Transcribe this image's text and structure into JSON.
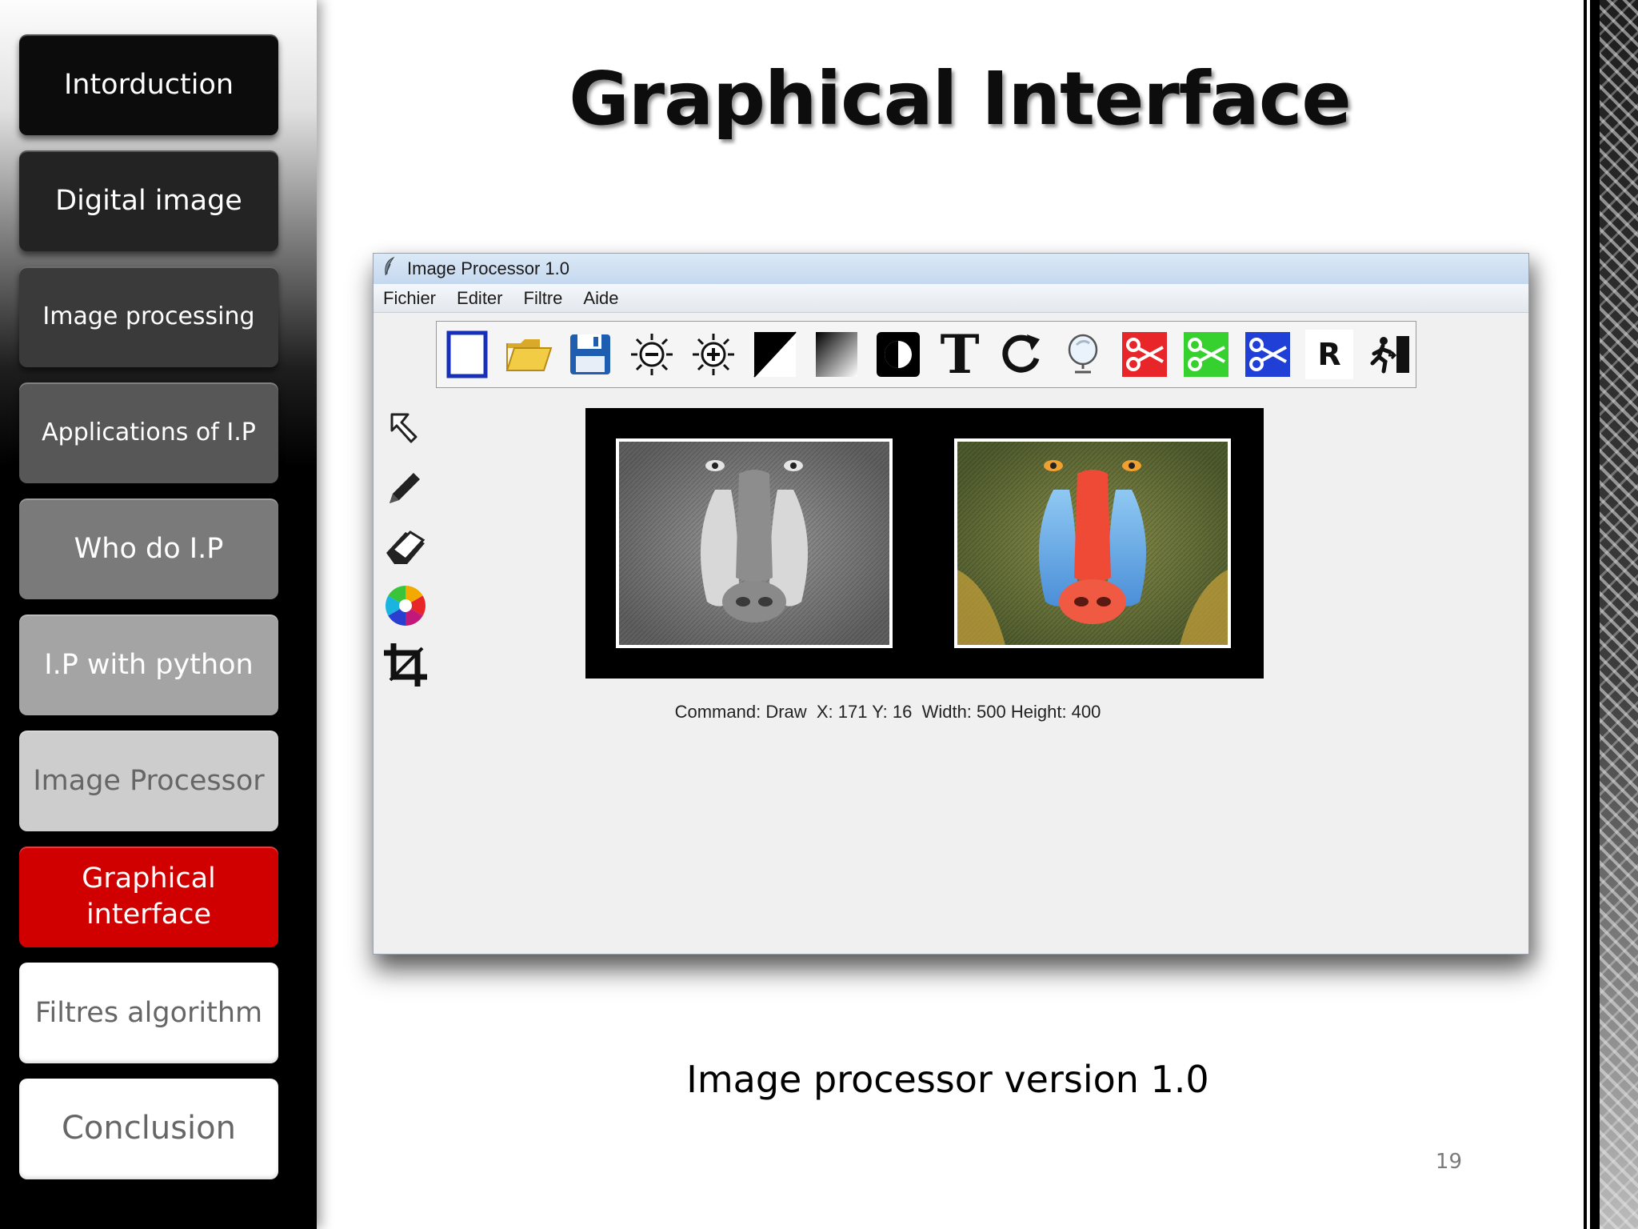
{
  "sidebar": {
    "items": [
      {
        "label": "Intorduction",
        "bg": "#0c0c0c",
        "color": "#ffffff"
      },
      {
        "label": "Digital image",
        "bg": "#232323",
        "color": "#ffffff"
      },
      {
        "label": "Image processing",
        "bg": "#3a3a3a",
        "color": "#ffffff"
      },
      {
        "label": "Applications of I.P",
        "bg": "#575757",
        "color": "#ffffff"
      },
      {
        "label": "Who do I.P",
        "bg": "#7a7a7a",
        "color": "#ffffff"
      },
      {
        "label": "I.P with python",
        "bg": "#a4a4a4",
        "color": "#ffffff"
      },
      {
        "label": "Image Processor",
        "bg": "#cdcdcd",
        "color": "#666666"
      },
      {
        "label": "Graphical interface",
        "bg": "#d10000",
        "color": "#ffffff"
      },
      {
        "label": "Filtres algorithm",
        "bg": "#ffffff",
        "color": "#666666"
      },
      {
        "label": "Conclusion",
        "bg": "#ffffff",
        "color": "#666666"
      }
    ],
    "active_index": 7
  },
  "slide": {
    "title": "Graphical Interface",
    "caption": "Image processor version 1.0",
    "page_number": "19"
  },
  "app": {
    "window_title": "Image Processor 1.0",
    "menu": [
      "Fichier",
      "Editer",
      "Filtre",
      "Aide"
    ],
    "toolbar_icons": [
      "new-file-icon",
      "open-folder-icon",
      "save-icon",
      "brightness-down-icon",
      "brightness-up-icon",
      "threshold-icon",
      "gradient-icon",
      "contrast-icon",
      "text-icon",
      "rotate-icon",
      "mirror-icon",
      "red-channel-cut-icon",
      "green-channel-cut-icon",
      "blue-channel-cut-icon",
      "reset-icon",
      "exit-icon"
    ],
    "reset_label": "R",
    "text_tool_label": "T",
    "side_tools": [
      "pointer-icon",
      "pencil-icon",
      "eraser-icon",
      "color-wheel-icon",
      "crop-icon"
    ],
    "status": "Command: Draw  X: 171 Y: 16  Width: 500 Height: 400",
    "colors": {
      "scissors_red": "#e8262a",
      "scissors_green": "#37d12f",
      "scissors_blue": "#1f3fd6",
      "new_file_border": "#1830b8",
      "folder": "#f2cc45",
      "save": "#1f5db0"
    }
  }
}
